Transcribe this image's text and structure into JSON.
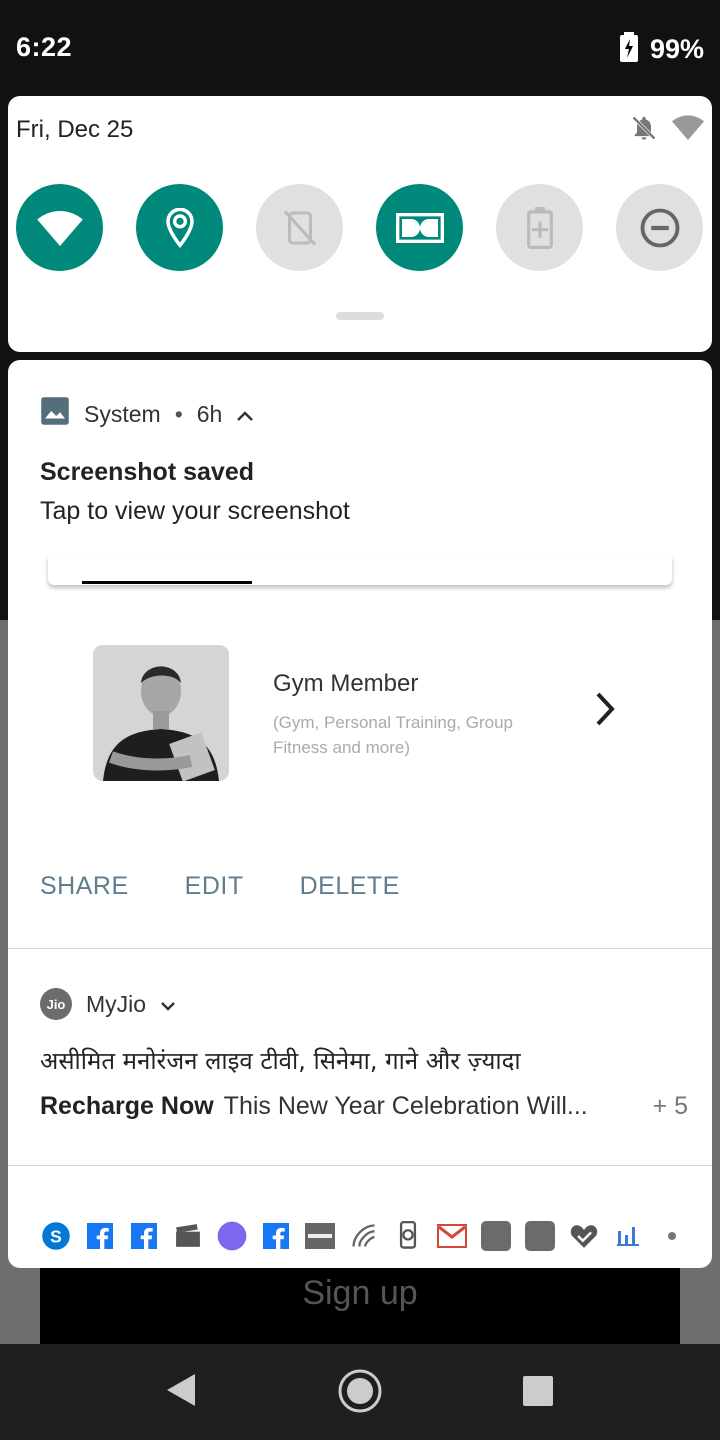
{
  "status_bar": {
    "time": "6:22",
    "battery": "99%"
  },
  "quick_settings": {
    "date": "Fri, Dec 25",
    "tiles": [
      {
        "name": "wifi",
        "on": true
      },
      {
        "name": "location",
        "on": true
      },
      {
        "name": "auto-rotate",
        "on": false
      },
      {
        "name": "dolby",
        "on": true
      },
      {
        "name": "battery-saver",
        "on": false
      },
      {
        "name": "do-not-disturb",
        "on": false
      }
    ]
  },
  "screenshot_notification": {
    "app": "System",
    "time": "6h",
    "title": "Screenshot saved",
    "text": "Tap to view your screenshot",
    "preview": {
      "title": "Gym Member",
      "subtitle": "(Gym, Personal Training, Group Fitness and more)"
    },
    "actions": [
      "SHARE",
      "EDIT",
      "DELETE"
    ]
  },
  "myjio_notification": {
    "app": "MyJio",
    "logo_text": "Jio",
    "hindi_text": "असीमित मनोरंजन लाइव टीवी, सिनेमा, गाने और ज़्यादा",
    "bold_text": "Recharge Now",
    "body_text": "This New Year Celebration Will...",
    "more_count": "+ 5"
  },
  "background": {
    "signup_label": "Sign up"
  },
  "app_icons": [
    "skype-icon",
    "facebook-icon",
    "facebook-icon",
    "clapper-icon",
    "circle-app-icon",
    "facebook-icon",
    "zomato-icon",
    "signal-icon",
    "phone-sync-icon",
    "gmail-icon",
    "app-icon",
    "app-icon",
    "heart-check-icon",
    "chart-icon",
    "more-dot-icon"
  ],
  "colors": {
    "accent": "#00897b",
    "action": "#5f7d8c"
  }
}
